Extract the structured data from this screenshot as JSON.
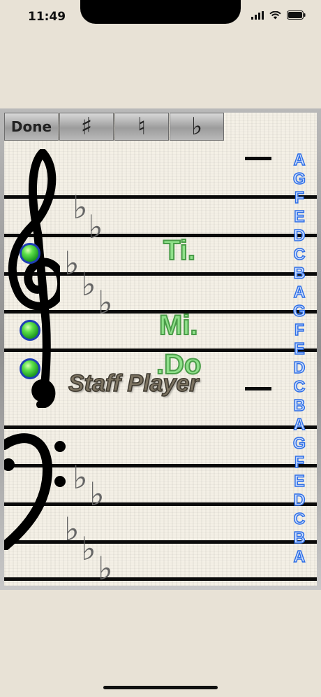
{
  "status_bar": {
    "time": "11:49"
  },
  "toolbar": {
    "done_label": "Done",
    "sharp_label": "♯",
    "natural_label": "♮",
    "flat_label": "♭"
  },
  "staff": {
    "treble_flats": [
      "♭",
      "♭",
      "♭",
      "♭",
      "♭"
    ],
    "bass_flats": [
      "♭",
      "♭",
      "♭",
      "♭",
      "♭"
    ],
    "solfege": [
      "Ti.",
      "Mi.",
      ".Do"
    ],
    "brand": "Staff Player",
    "note_letters": [
      "A",
      "G",
      "F",
      "E",
      "D",
      "C",
      "B",
      "A",
      "G",
      "F",
      "E",
      "D",
      "C",
      "B",
      "A",
      "G",
      "F",
      "E",
      "D",
      "C",
      "B",
      "A"
    ]
  },
  "colors": {
    "background": "#e8e2d6",
    "note_green": "#2fb52f",
    "note_border": "#1f3fb5",
    "letter_blue": "#2f6fe6",
    "solfege_green": "#8fe08a"
  }
}
